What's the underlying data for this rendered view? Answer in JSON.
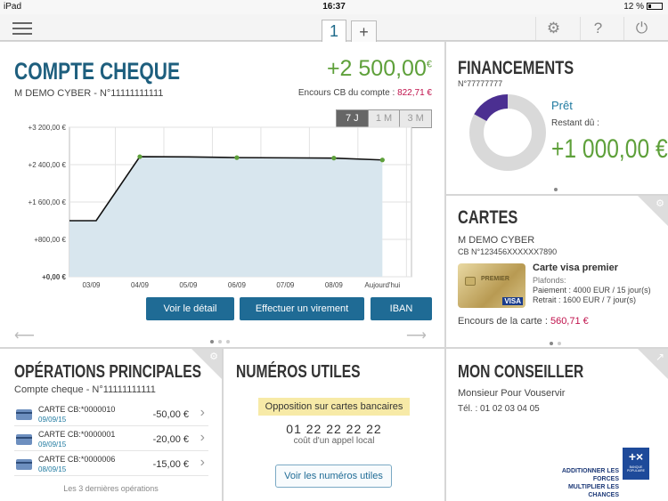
{
  "status_bar": {
    "device": "iPad",
    "time": "16:37",
    "battery": "12 %"
  },
  "toolbar": {
    "tabs": [
      "1",
      "+"
    ]
  },
  "compte": {
    "title": "COMPTE CHEQUE",
    "holder": "M DEMO CYBER - N°11111111111",
    "balance": "+2 500,00",
    "currency": "€",
    "encours_label": "Encours CB du compte : ",
    "encours_value": "822,71 €",
    "periods": [
      "7 J",
      "1 M",
      "3 M"
    ],
    "btn_detail": "Voir le détail",
    "btn_virement": "Effectuer un virement",
    "btn_iban": "IBAN"
  },
  "chart_data": {
    "type": "area",
    "categories": [
      "03/09",
      "04/09",
      "05/09",
      "06/09",
      "07/09",
      "08/09",
      "Aujourd'hui"
    ],
    "y_ticks": [
      "+3 200,00 €",
      "+2 400,00 €",
      "+1 600,00 €",
      "+800,00 €",
      "+0,00 €"
    ],
    "ylim": [
      0,
      3200
    ],
    "points": [
      {
        "x": 2.55,
        "y": 1200
      },
      {
        "x": 3.1,
        "y": 1200
      },
      {
        "x": 4.0,
        "y": 2570,
        "marker": true
      },
      {
        "x": 5.0,
        "y": 2565
      },
      {
        "x": 6.0,
        "y": 2550,
        "marker": true
      },
      {
        "x": 7.0,
        "y": 2545
      },
      {
        "x": 8.0,
        "y": 2540,
        "marker": true
      },
      {
        "x": 9.0,
        "y": 2500,
        "marker": true
      }
    ],
    "colors": {
      "fill": "#d8e6ee",
      "line": "#111111",
      "marker": "#5ea03a"
    }
  },
  "financements": {
    "title": "FINANCEMENTS",
    "number": "N°77777777",
    "loan_type": "Prêt",
    "remaining_label": "Restant dû :",
    "remaining_value": "+1 000,00 €",
    "donut_fraction": 0.17,
    "colors": {
      "part": "#4b2f91",
      "rest": "#d9d9d9"
    }
  },
  "cartes": {
    "title": "CARTES",
    "holder": "M DEMO CYBER",
    "number": "CB N°123456XXXXXX7890",
    "card_name": "Carte visa premier",
    "plafonds_label": "Plafonds:",
    "paiement": "Paiement : 4000 EUR / 15 jour(s)",
    "retrait": "Retrait : 1600 EUR / 7 jour(s)",
    "card_brand": "VISA",
    "card_label": "PREMIER",
    "encours_label": "Encours de la carte : ",
    "encours_value": "560,71 €"
  },
  "operations": {
    "title": "OPÉRATIONS PRINCIPALES",
    "account": "Compte cheque - N°11111111111",
    "rows": [
      {
        "label": "CARTE CB:*0000010",
        "date": "09/09/15",
        "amount": "-50,00 €"
      },
      {
        "label": "CARTE CB:*0000001",
        "date": "09/09/15",
        "amount": "-20,00 €"
      },
      {
        "label": "CARTE CB:*0000006",
        "date": "08/09/15",
        "amount": "-15,00 €"
      }
    ],
    "footer": "Les 3 dernières opérations"
  },
  "numeros": {
    "title": "NUMÉROS UTILES",
    "opposition": "Opposition sur cartes bancaires",
    "phone": "01 22 22 22 22",
    "cost": "coût d'un appel local",
    "btn": "Voir les numéros utiles"
  },
  "conseiller": {
    "title": "MON CONSEILLER",
    "name": "Monsieur Pour Vouservir",
    "tel": "Tél. : 01 02 03 04 05",
    "slogan1": "ADDITIONNER LES FORCES",
    "slogan2": "MULTIPLIER LES CHANCES",
    "logo_text": "BANQUE POPULAIRE"
  }
}
